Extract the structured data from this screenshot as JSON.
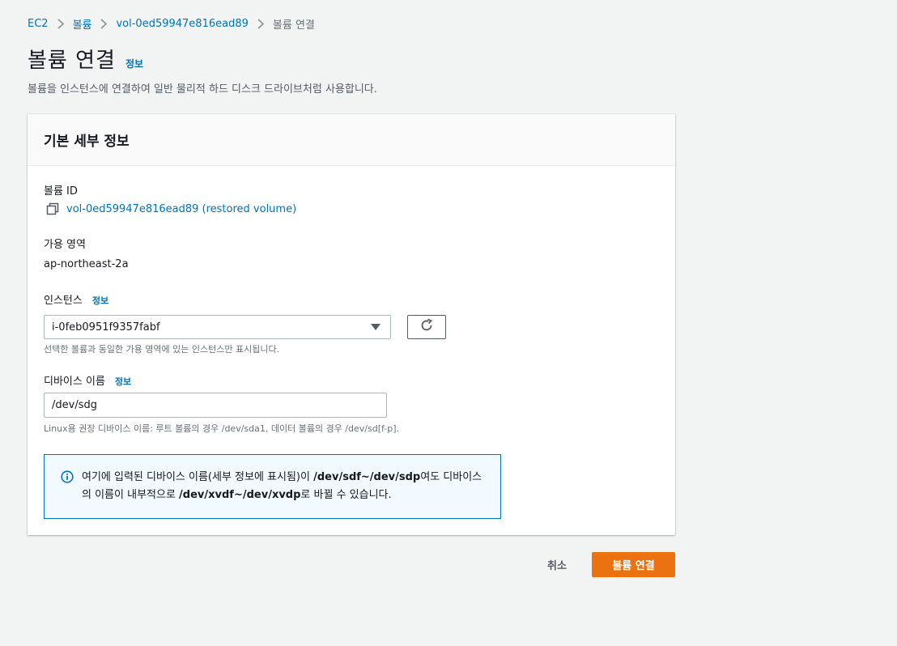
{
  "breadcrumb": {
    "items": [
      "EC2",
      "볼륨",
      "vol-0ed59947e816ead89"
    ],
    "current": "볼륨 연결"
  },
  "header": {
    "title": "볼륨 연결",
    "info_link": "정보",
    "description": "볼륨을 인스턴스에 연결하여 일반 물리적 하드 디스크 드라이브처럼 사용합니다."
  },
  "panel": {
    "title": "기본 세부 정보",
    "volume_id": {
      "label": "볼륨 ID",
      "value": "vol-0ed59947e816ead89 (restored volume)"
    },
    "availability_zone": {
      "label": "가용 영역",
      "value": "ap-northeast-2a"
    },
    "instance": {
      "label": "인스턴스",
      "info_link": "정보",
      "selected": "i-0feb0951f9357fabf",
      "hint": "선택한 볼륨과 동일한 가용 영역에 있는 인스턴스만 표시됩니다."
    },
    "device_name": {
      "label": "디바이스 이름",
      "info_link": "정보",
      "value": "/dev/sdg",
      "hint": "Linux용 권장 디바이스 이름: 루트 볼륨의 경우 /dev/sda1, 데이터 볼륨의 경우 /dev/sd[f-p]."
    },
    "alert": {
      "part1": "여기에 입력된 디바이스 이름(세부 정보에 표시됨)이 ",
      "bold1": "/dev/sdf~/dev/sdp",
      "part2": "여도 디바이스의 이름이 내부적으로 ",
      "bold2": "/dev/xvdf~/dev/xvdp",
      "part3": "로 바뀔 수 있습니다."
    }
  },
  "actions": {
    "cancel": "취소",
    "submit": "볼륨 연결"
  },
  "icons": {
    "breadcrumb_separator": "chevron-right-icon",
    "copy": "copy-icon",
    "select_caret": "caret-down-icon",
    "refresh": "refresh-icon",
    "alert": "info-icon"
  },
  "colors": {
    "link": "#0073bb",
    "primary_button": "#ec7211",
    "alert_border": "#0073bb",
    "alert_background": "#f1faff",
    "page_background": "#f2f3f3"
  }
}
